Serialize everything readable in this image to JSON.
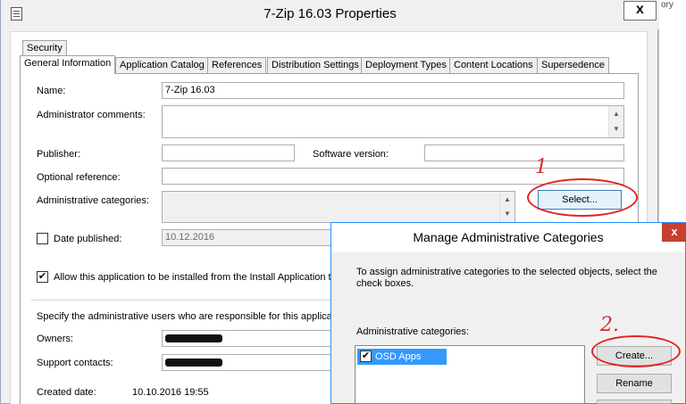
{
  "window": {
    "title": "7-Zip 16.03 Properties",
    "close_label": "x",
    "right_edge_text": "ory"
  },
  "tabs": {
    "row1": [
      "Security"
    ],
    "row2": [
      "General Information",
      "Application Catalog",
      "References",
      "Distribution Settings",
      "Deployment Types",
      "Content Locations",
      "Supersedence"
    ]
  },
  "general": {
    "name_label": "Name:",
    "name_value": "7-Zip 16.03",
    "admin_comments_label": "Administrator comments:",
    "publisher_label": "Publisher:",
    "software_version_label": "Software version:",
    "optional_reference_label": "Optional reference:",
    "admin_categories_label": "Administrative categories:",
    "select_button": "Select...",
    "date_published_label": "Date published:",
    "date_published_value": "10.12.2016",
    "allow_install_label": "Allow this application to be installed from the Install Application tas",
    "specify_label": "Specify the administrative users who are responsible for this application",
    "owners_label": "Owners:",
    "support_contacts_label": "Support contacts:",
    "created_date_label": "Created date:",
    "created_date_value": "10.10.2016 19:55"
  },
  "dialog": {
    "title": "Manage Administrative Categories",
    "close_label": "x",
    "instruction": "To assign administrative categories to the selected objects, select the check boxes.",
    "categories_label": "Administrative categories:",
    "items": [
      {
        "label": "OSD Apps",
        "checked": true
      }
    ],
    "create_button": "Create...",
    "rename_button": "Rename"
  },
  "annotations": {
    "mark1": "1",
    "mark2": "2."
  },
  "colors": {
    "annotation_red": "#e02424",
    "selection_blue": "#3399ff",
    "dialog_border": "#1e90ff"
  }
}
